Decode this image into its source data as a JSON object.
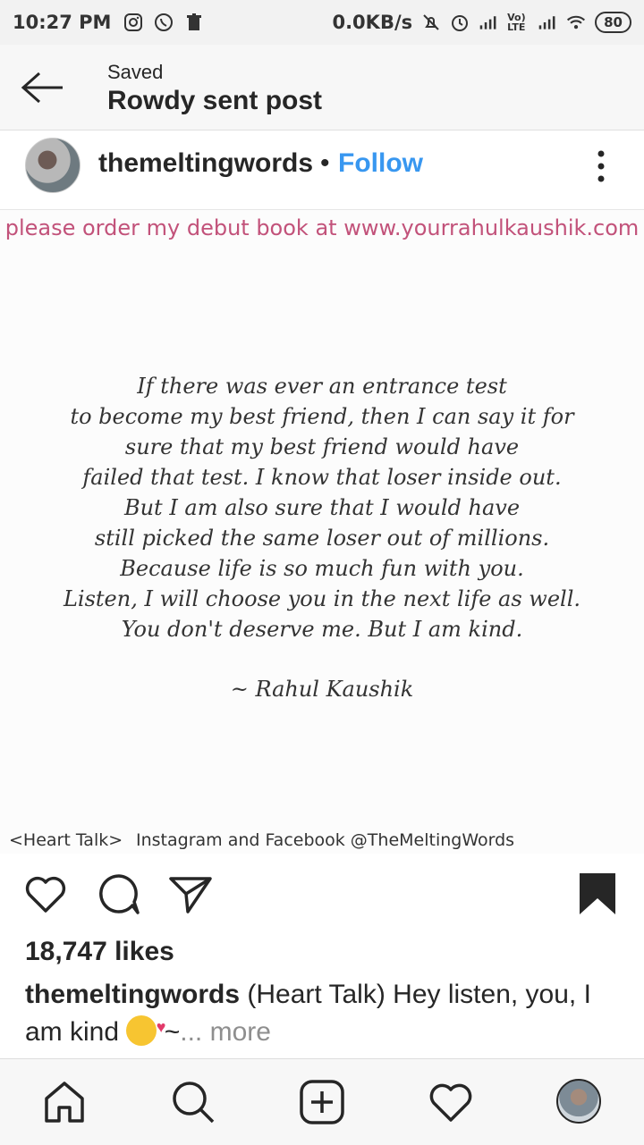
{
  "status_bar": {
    "time": "10:27 PM",
    "speed": "0.0KB/s",
    "network": "Vo) LTE",
    "battery": "80"
  },
  "header": {
    "subtitle": "Saved",
    "title": "Rowdy sent post"
  },
  "post": {
    "username": "themeltingwords",
    "separator": "•",
    "follow_label": "Follow",
    "promo_text": "please order my debut book at www.yourrahulkaushik.com",
    "quote_lines": [
      "If there was ever an entrance test",
      "to become my best friend, then I can say it for",
      "sure that my best friend would have",
      "failed that test. I know that loser inside out.",
      "But I am also sure that I would have",
      "still picked the same loser out of millions.",
      "Because life is so much fun with you.",
      "Listen, I will choose you in the next life as well.",
      "You don't deserve me. But I am kind."
    ],
    "signature": "~ Rahul Kaushik",
    "footer_left": "<Heart Talk>",
    "footer_right": "Instagram and Facebook @TheMeltingWords",
    "likes": "18,747 likes",
    "caption_user": "themeltingwords",
    "caption_text": " (Heart Talk) Hey listen, you, I am kind ",
    "caption_tail": " ~",
    "more_label": "... more"
  },
  "icons": {
    "back": "back-arrow-icon",
    "menu": "more-vertical-icon",
    "like": "heart-icon",
    "comment": "comment-icon",
    "share": "send-icon",
    "save": "bookmark-icon",
    "home": "home-icon",
    "search": "search-icon",
    "add": "add-post-icon",
    "activity": "heart-icon",
    "profile": "profile-avatar"
  },
  "colors": {
    "follow": "#3897f0",
    "promo": "#c2527a",
    "muted": "#8e8e8e"
  }
}
